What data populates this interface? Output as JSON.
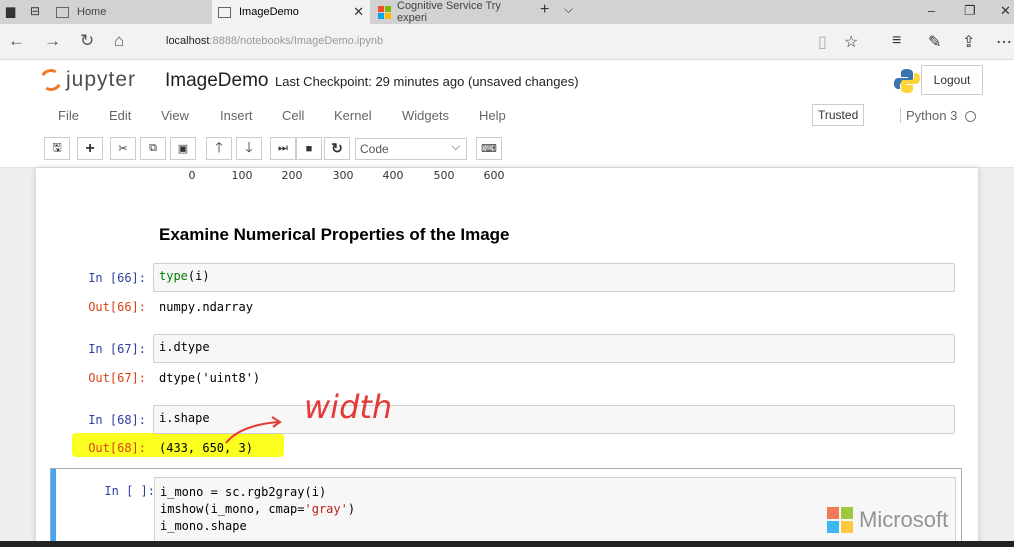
{
  "browser": {
    "tabs": [
      {
        "label": "Home"
      },
      {
        "label": "ImageDemo",
        "active": true
      },
      {
        "label": "Cognitive Service Try experi"
      }
    ],
    "url_host": "localhost",
    "url_rest": ":8888/notebooks/ImageDemo.ipynb"
  },
  "jupyter": {
    "logo_text": "jupyter",
    "notebook_title": "ImageDemo",
    "checkpoint": "Last Checkpoint: 29 minutes ago (unsaved changes)",
    "logout_label": "Logout"
  },
  "menubar": {
    "items": [
      "File",
      "Edit",
      "View",
      "Insert",
      "Cell",
      "Kernel",
      "Widgets",
      "Help"
    ],
    "trusted_label": "Trusted",
    "kernel_name": "Python 3"
  },
  "toolbar": {
    "cell_type": "Code",
    "buttons": [
      "save-icon",
      "plus-icon",
      "cut-icon",
      "copy-icon",
      "paste-icon",
      "arrow-up-icon",
      "arrow-down-icon",
      "run-icon",
      "stop-icon",
      "restart-icon",
      "keyboard-icon"
    ]
  },
  "notebook": {
    "axis_ticks": [
      "0",
      "100",
      "200",
      "300",
      "400",
      "500",
      "600"
    ],
    "markdown_heading": "Examine Numerical Properties of the Image",
    "cells": [
      {
        "in_prompt": "In [66]:",
        "code_a": "type",
        "code_b": "(i)",
        "out_prompt": "Out[66]:",
        "output": "numpy.ndarray"
      },
      {
        "in_prompt": "In [67]:",
        "code": "i.dtype",
        "out_prompt": "Out[67]:",
        "output": "dtype('uint8')"
      },
      {
        "in_prompt": "In [68]:",
        "code": "i.shape",
        "out_prompt": "Out[68]:",
        "output": "(433, 650, 3)"
      },
      {
        "in_prompt": "In [ ]:",
        "line1": "i_mono = sc.rgb2gray(i)",
        "line2_a": "imshow(i_mono, cmap=",
        "line2_str": "'gray'",
        "line2_b": ")",
        "line3": "i_mono.shape"
      }
    ],
    "annotation": "width"
  },
  "watermark": {
    "brand": "Microsoft",
    "colors": [
      "#f25022",
      "#7fba00",
      "#00a4ef",
      "#ffb900"
    ]
  }
}
